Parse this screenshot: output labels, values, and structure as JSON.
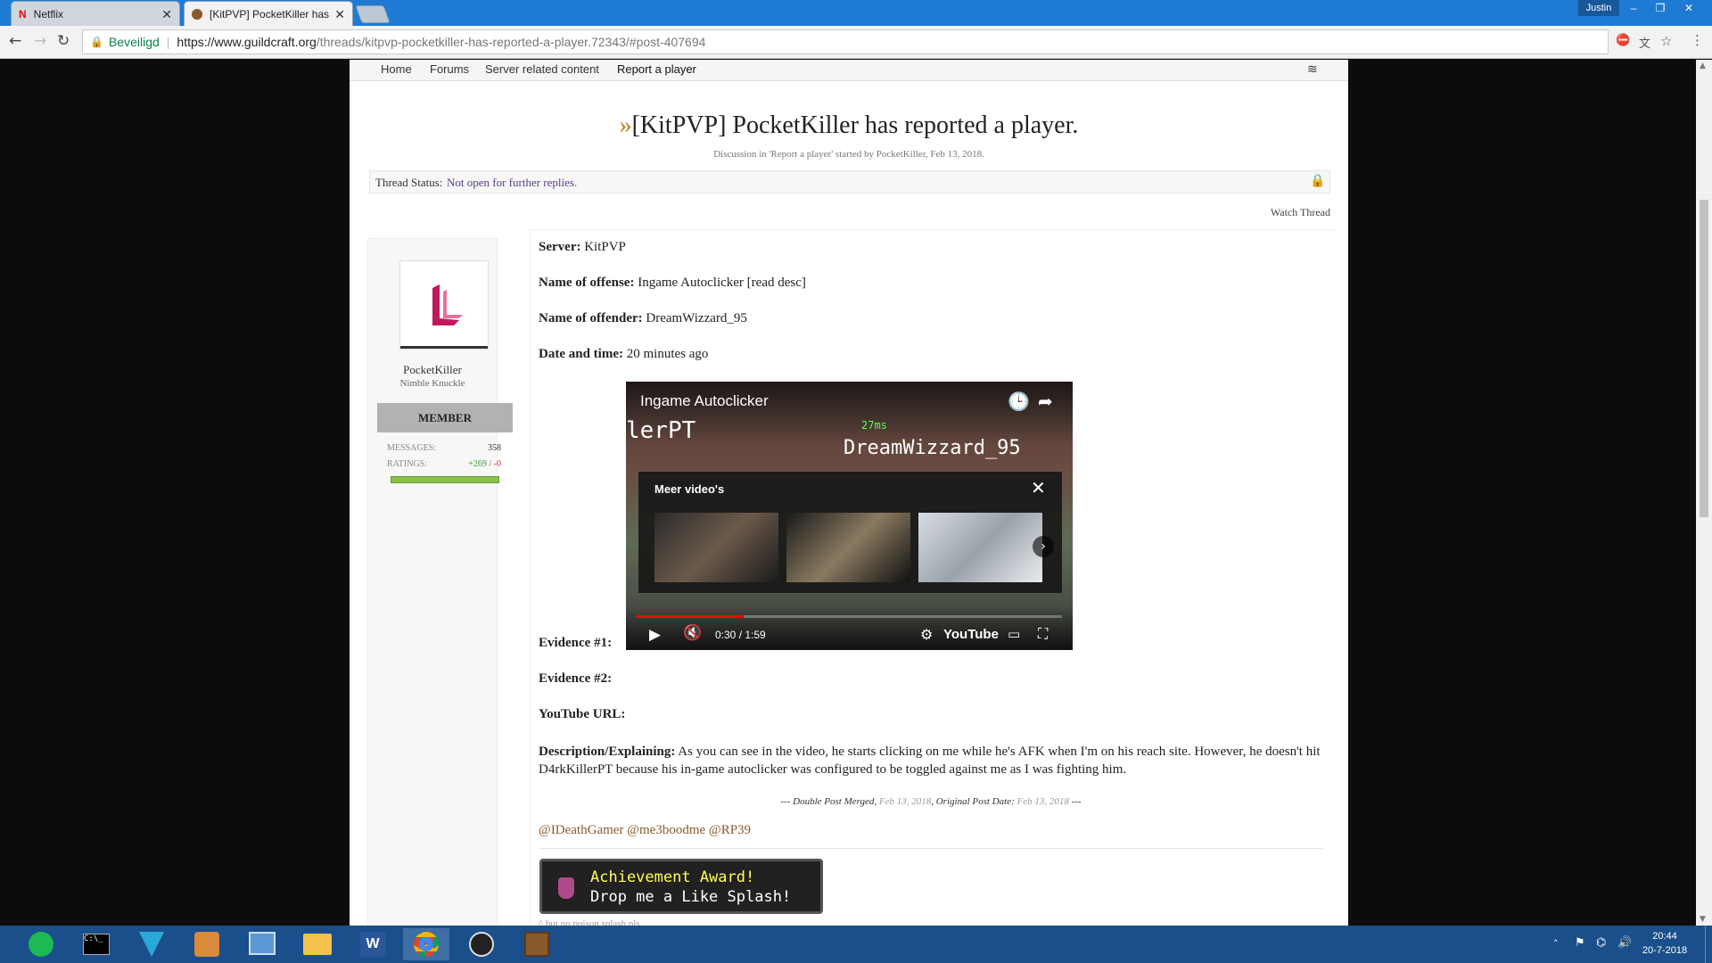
{
  "tabs": [
    {
      "title": "Netflix",
      "icon": "netflix-icon"
    },
    {
      "title": "[KitPVP] PocketKiller has",
      "icon": "guildcraft-icon"
    }
  ],
  "window": {
    "user": "Justin",
    "minimize": "–",
    "restore": "❐",
    "close": "✕"
  },
  "address": {
    "secure_label": "Beveiligd",
    "url_host": "https://www.guildcraft.org",
    "url_path": "/threads/kitpvp-pocketkiller-has-reported-a-player.72343/#post-407694"
  },
  "nav": {
    "home": "Home",
    "forums": "Forums",
    "server_content": "Server related content",
    "report": "Report a player"
  },
  "thread": {
    "title_arrow": "»",
    "title": "[KitPVP] PocketKiller has reported a player.",
    "meta": "Discussion in 'Report a player' started by PocketKiller, Feb 13, 2018.",
    "status_label": "Thread Status:",
    "status_value": "Not open for further replies.",
    "watch": "Watch Thread"
  },
  "user": {
    "name": "PocketKiller",
    "title": "Nimble Knuckle",
    "badge": "MEMBER",
    "messages_label": "MESSAGES:",
    "messages_value": "358",
    "ratings_label": "RATINGS:",
    "ratings_pos": "+269",
    "ratings_sep": " / ",
    "ratings_neg": "-0"
  },
  "post": {
    "server_label": "Server:",
    "server_value": "KitPVP",
    "offense_label": "Name of offense:",
    "offense_value": "Ingame Autoclicker [read desc]",
    "offender_label": "Name of offender:",
    "offender_value": "DreamWizzard_95",
    "date_label": "Date and time:",
    "date_value": "20 minutes ago",
    "evidence1_label": "Evidence #1:",
    "evidence2_label": "Evidence #2:",
    "youtube_label": "YouTube URL:",
    "desc_label": "Description/Explaining:",
    "desc_value": "As you can see in the video, he starts clicking on me while he's AFK when I'm on his reach site. However, he doesn't hit D4rkKillerPT because his in-game autoclicker was configured to be toggled against me as I was fighting him.",
    "merged_prefix": "--- Double Post Merged, ",
    "merged_date": "Feb 13, 2018",
    "merged_mid": ", Original Post Date: ",
    "merged_orig": "Feb 13, 2018",
    "merged_suffix": " ---",
    "mentions": "@IDeathGamer @me3boodme @RP39",
    "ach_line1": "Achievement Award!",
    "ach_line2": "Drop me a Like Splash!",
    "footnote": "^ but no poison splash pls"
  },
  "video": {
    "title": "Ingame Autoclicker",
    "overlay_title": "Meer video's",
    "time": "0:30 / 1:59",
    "brand": "YouTube",
    "ingame_text1": "lerPT",
    "ingame_text2": "DreamWizzard_95",
    "ping": "27ms",
    "progress": 0.252
  },
  "taskbar": {
    "time": "20:44",
    "date": "20-7-2018",
    "apps": [
      "spotify-icon",
      "terminal-icon",
      "vector-icon",
      "scripts-icon",
      "control-panel-icon",
      "file-explorer-icon",
      "word-icon",
      "chrome-icon",
      "satellite-icon",
      "minecraft-icon"
    ]
  },
  "colors": {
    "tabbar": "#1e7ad3",
    "secure": "#0b8043",
    "link": "#5a3d8a",
    "rating_pos": "#27a127",
    "rating_neg": "#d32f2f",
    "lock": "#f0b429",
    "taskbar": "#1a4f8b"
  }
}
